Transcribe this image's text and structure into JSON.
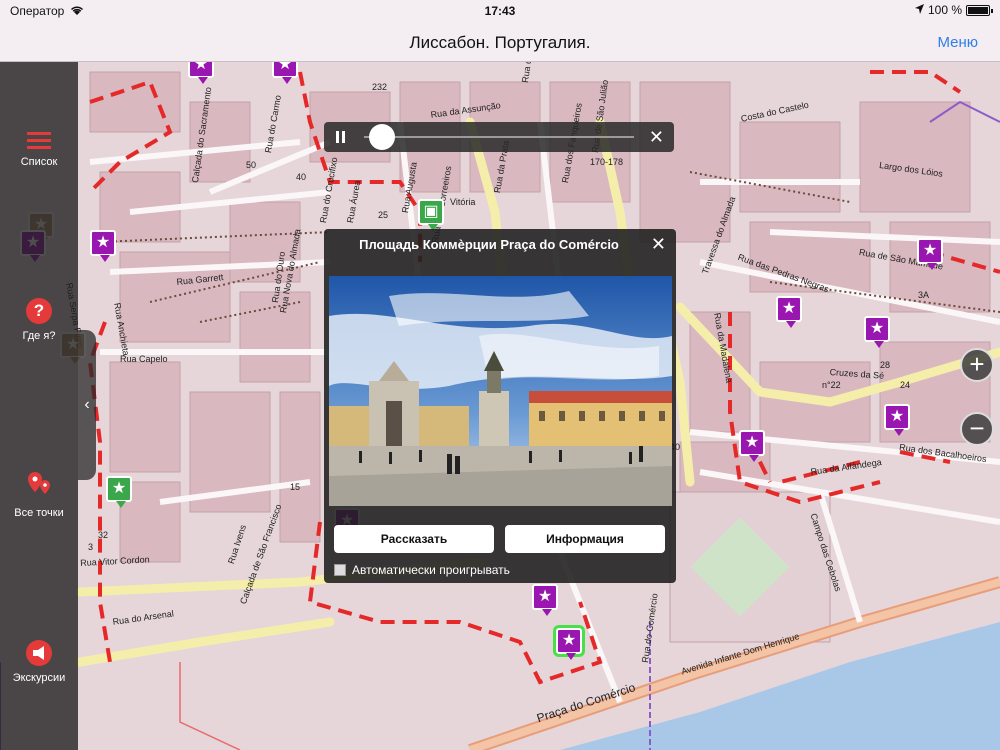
{
  "status": {
    "carrier": "Оператор",
    "time": "17:43",
    "battery": "100 %"
  },
  "nav": {
    "title": "Лиссабон. Португалия.",
    "menu": "Меню"
  },
  "sidebar": {
    "list_label": "Список",
    "where_label": "Где я?",
    "all_points_label": "Все точки",
    "tours_label": "Экскурсии"
  },
  "popup": {
    "title": "Площадь Коммèрции Praça do Comércio",
    "tell_button": "Рассказать",
    "info_button": "Информация",
    "autoplay_label": "Автоматически проигрывать"
  },
  "map": {
    "labels": [
      "Rua da Assunção",
      "Rua dos Fanqueiros",
      "Rua dos Correeiros",
      "Rua da Prata",
      "Rua Augusta",
      "Rua Áurea",
      "Rua do Crucifixo",
      "Rua do Carmo",
      "Rua Garrett",
      "Calçada de São Francisco",
      "Rua Ivens",
      "Rua Capelo",
      "Rua Vitor Cordon",
      "Rua do Arsenal",
      "Praça do Comércio",
      "Avenida Infante Dom Henrique",
      "Campo das Cebolas",
      "Rua da Alfândega",
      "Rua dos Bacalhoeiros",
      "Cruzes da Sé",
      "Rua das Pedras Negras",
      "Rua de São Mamede",
      "Travessa do Almada",
      "Costa do Castelo",
      "Largo dos Lóios",
      "Rua da Madalena",
      "Rua Serpa Pinto",
      "Rua Anchieta",
      "Rua Nova do Almada",
      "Vitória",
      "Calçada do Sacramento",
      "Rua de São Julião",
      "Rua do Comércio",
      "Rua da Conceição",
      "Rua do Ouro"
    ],
    "numbers": [
      "232",
      "170-178",
      "3A",
      "n°22",
      "25",
      "32",
      "50",
      "40",
      "15",
      "1",
      "28",
      "3",
      "40",
      "24"
    ]
  }
}
